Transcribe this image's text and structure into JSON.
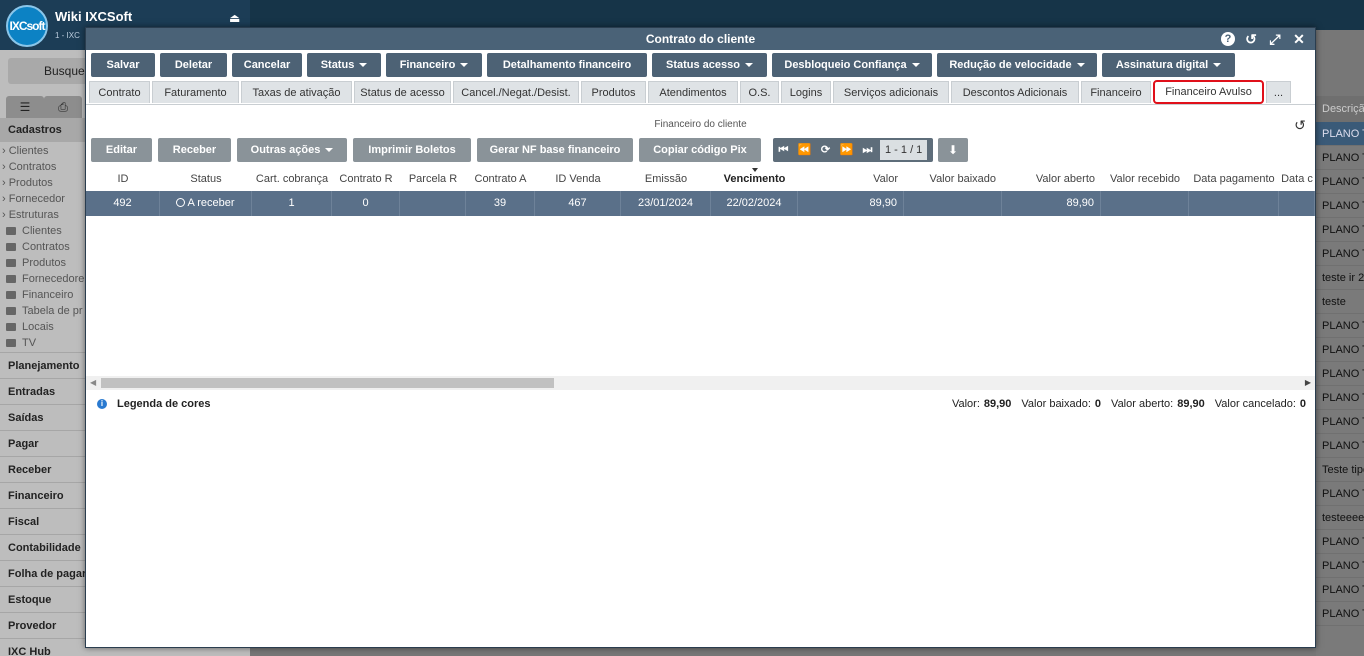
{
  "app": {
    "logo_text": "IXCsoft",
    "title": "Wiki IXCSoft",
    "subtitle": "1 - IXC",
    "search_placeholder": "Busque",
    "cadastros": "Cadastros",
    "tree_arrows": [
      "Clientes",
      "Contratos",
      "Produtos",
      "Fornecedor",
      "Estruturas"
    ],
    "tree_folders": [
      "Clientes",
      "Contratos",
      "Produtos",
      "Fornecedore",
      "Financeiro",
      "Tabela de pr",
      "Locais",
      "TV"
    ],
    "menu": [
      "Planejamento",
      "Entradas",
      "Saídas",
      "Pagar",
      "Receber",
      "Financeiro",
      "Fiscal",
      "Contabilidade",
      "Folha de pagar",
      "Estoque",
      "Provedor",
      "IXC Hub"
    ],
    "right_col_header": "Descriçã",
    "right_col_rows": [
      "PLANO T",
      "PLANO T",
      "PLANO T",
      "PLANO T",
      "PLANO T",
      "PLANO T",
      "teste ir 2",
      "teste",
      "PLANO T",
      "PLANO T",
      "PLANO T",
      "PLANO T",
      "PLANO T",
      "PLANO T",
      "Teste tipo",
      "PLANO T",
      "testeeee",
      "PLANO T",
      "PLANO T",
      "PLANO T",
      "PLANO T"
    ]
  },
  "modal": {
    "title": "Contrato do cliente",
    "toolbar": [
      {
        "label": "Salvar",
        "dropdown": false
      },
      {
        "label": "Deletar",
        "dropdown": false
      },
      {
        "label": "Cancelar",
        "dropdown": false
      },
      {
        "label": "Status",
        "dropdown": true
      },
      {
        "label": "Financeiro",
        "dropdown": true
      },
      {
        "label": "Detalhamento financeiro",
        "dropdown": false
      },
      {
        "label": "Status acesso",
        "dropdown": true
      },
      {
        "label": "Desbloqueio Confiança",
        "dropdown": true
      },
      {
        "label": "Redução de velocidade",
        "dropdown": true
      },
      {
        "label": "Assinatura digital",
        "dropdown": true
      }
    ],
    "tabs": [
      "Contrato",
      "Faturamento",
      "Taxas de ativação",
      "Status de acesso",
      "Cancel./Negat./Desist.",
      "Produtos",
      "Atendimentos",
      "O.S.",
      "Logins",
      "Serviços adicionais",
      "Descontos Adicionais",
      "Financeiro",
      "Financeiro Avulso",
      "..."
    ],
    "active_tab": "Financeiro Avulso",
    "section_title": "Financeiro do cliente",
    "actions": [
      {
        "label": "Editar",
        "dropdown": false
      },
      {
        "label": "Receber",
        "dropdown": false
      },
      {
        "label": "Outras ações",
        "dropdown": true
      },
      {
        "label": "Imprimir Boletos",
        "dropdown": false
      },
      {
        "label": "Gerar NF base financeiro",
        "dropdown": false
      },
      {
        "label": "Copiar código Pix",
        "dropdown": false
      }
    ],
    "pager": {
      "count": "1 - 1 / 1"
    },
    "grid": {
      "columns": [
        "ID",
        "Status",
        "Cart. cobrança",
        "Contrato R",
        "Parcela R",
        "Contrato A",
        "ID Venda",
        "Emissão",
        "Vencimento",
        "Valor",
        "Valor baixado",
        "Valor aberto",
        "Valor recebido",
        "Data pagamento",
        "Data c"
      ],
      "sorted_column": "Vencimento",
      "rows": [
        [
          "492",
          "A receber",
          "1",
          "0",
          "",
          "39",
          "467",
          "23/01/2024",
          "22/02/2024",
          "89,90",
          "",
          "89,90",
          "",
          "",
          ""
        ]
      ]
    },
    "footer": {
      "legend": "Legenda de cores",
      "valor_label": "Valor:",
      "valor": "89,90",
      "baixado_label": "Valor baixado:",
      "baixado": "0",
      "aberto_label": "Valor aberto:",
      "aberto": "89,90",
      "cancelado_label": "Valor cancelado:",
      "cancelado": "0"
    }
  }
}
